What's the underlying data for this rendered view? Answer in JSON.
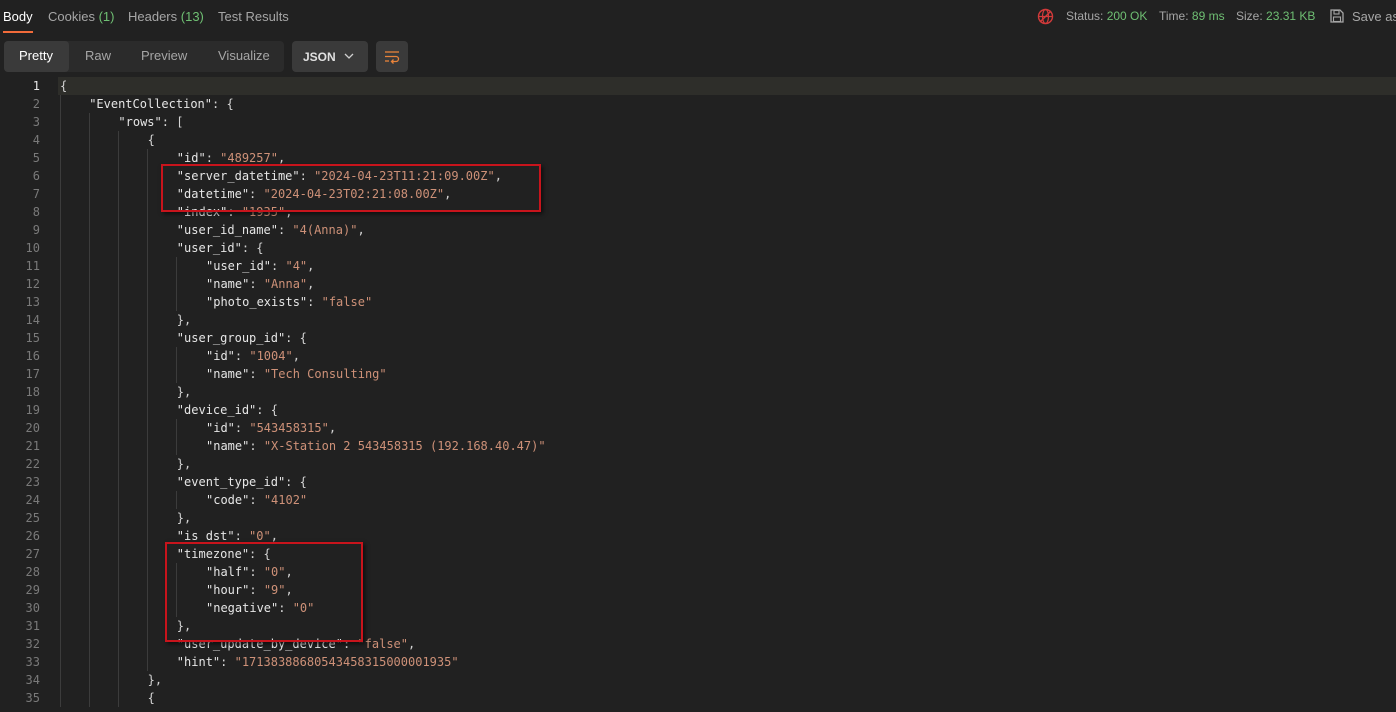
{
  "top_tabs": [
    {
      "label": "Body",
      "count": ""
    },
    {
      "label": "Cookies",
      "count": "(1)"
    },
    {
      "label": "Headers",
      "count": "(13)"
    },
    {
      "label": "Test Results",
      "count": ""
    }
  ],
  "status": {
    "status_label": "Status:",
    "status_value": "200 OK",
    "time_label": "Time:",
    "time_value": "89 ms",
    "size_label": "Size:",
    "size_value": "23.31 KB"
  },
  "save_label": "Save as",
  "view_tabs": [
    "Pretty",
    "Raw",
    "Preview",
    "Visualize"
  ],
  "format_select": "JSON",
  "code_lines": [
    {
      "n": "1",
      "indent": 0,
      "parts": [
        [
          "p",
          "{"
        ]
      ]
    },
    {
      "n": "2",
      "indent": 1,
      "parts": [
        [
          "k",
          "\"EventCollection\""
        ],
        [
          "p",
          ": {"
        ]
      ]
    },
    {
      "n": "3",
      "indent": 2,
      "parts": [
        [
          "k",
          "\"rows\""
        ],
        [
          "p",
          ": ["
        ]
      ]
    },
    {
      "n": "4",
      "indent": 3,
      "parts": [
        [
          "p",
          "{"
        ]
      ]
    },
    {
      "n": "5",
      "indent": 4,
      "parts": [
        [
          "k",
          "\"id\""
        ],
        [
          "p",
          ": "
        ],
        [
          "s",
          "\"489257\""
        ],
        [
          "p",
          ","
        ]
      ]
    },
    {
      "n": "6",
      "indent": 4,
      "parts": [
        [
          "k",
          "\"server_datetime\""
        ],
        [
          "p",
          ": "
        ],
        [
          "s",
          "\"2024-04-23T11:21:09.00Z\""
        ],
        [
          "p",
          ","
        ]
      ]
    },
    {
      "n": "7",
      "indent": 4,
      "parts": [
        [
          "k",
          "\"datetime\""
        ],
        [
          "p",
          ": "
        ],
        [
          "s",
          "\"2024-04-23T02:21:08.00Z\""
        ],
        [
          "p",
          ","
        ]
      ]
    },
    {
      "n": "8",
      "indent": 4,
      "parts": [
        [
          "k",
          "\"index\""
        ],
        [
          "p",
          ": "
        ],
        [
          "s",
          "\"1935\""
        ],
        [
          "p",
          ","
        ]
      ]
    },
    {
      "n": "9",
      "indent": 4,
      "parts": [
        [
          "k",
          "\"user_id_name\""
        ],
        [
          "p",
          ": "
        ],
        [
          "s",
          "\"4(Anna)\""
        ],
        [
          "p",
          ","
        ]
      ]
    },
    {
      "n": "10",
      "indent": 4,
      "parts": [
        [
          "k",
          "\"user_id\""
        ],
        [
          "p",
          ": {"
        ]
      ]
    },
    {
      "n": "11",
      "indent": 5,
      "parts": [
        [
          "k",
          "\"user_id\""
        ],
        [
          "p",
          ": "
        ],
        [
          "s",
          "\"4\""
        ],
        [
          "p",
          ","
        ]
      ]
    },
    {
      "n": "12",
      "indent": 5,
      "parts": [
        [
          "k",
          "\"name\""
        ],
        [
          "p",
          ": "
        ],
        [
          "s",
          "\"Anna\""
        ],
        [
          "p",
          ","
        ]
      ]
    },
    {
      "n": "13",
      "indent": 5,
      "parts": [
        [
          "k",
          "\"photo_exists\""
        ],
        [
          "p",
          ": "
        ],
        [
          "s",
          "\"false\""
        ]
      ]
    },
    {
      "n": "14",
      "indent": 4,
      "parts": [
        [
          "p",
          "},"
        ]
      ]
    },
    {
      "n": "15",
      "indent": 4,
      "parts": [
        [
          "k",
          "\"user_group_id\""
        ],
        [
          "p",
          ": {"
        ]
      ]
    },
    {
      "n": "16",
      "indent": 5,
      "parts": [
        [
          "k",
          "\"id\""
        ],
        [
          "p",
          ": "
        ],
        [
          "s",
          "\"1004\""
        ],
        [
          "p",
          ","
        ]
      ]
    },
    {
      "n": "17",
      "indent": 5,
      "parts": [
        [
          "k",
          "\"name\""
        ],
        [
          "p",
          ": "
        ],
        [
          "s",
          "\"Tech Consulting\""
        ]
      ]
    },
    {
      "n": "18",
      "indent": 4,
      "parts": [
        [
          "p",
          "},"
        ]
      ]
    },
    {
      "n": "19",
      "indent": 4,
      "parts": [
        [
          "k",
          "\"device_id\""
        ],
        [
          "p",
          ": {"
        ]
      ]
    },
    {
      "n": "20",
      "indent": 5,
      "parts": [
        [
          "k",
          "\"id\""
        ],
        [
          "p",
          ": "
        ],
        [
          "s",
          "\"543458315\""
        ],
        [
          "p",
          ","
        ]
      ]
    },
    {
      "n": "21",
      "indent": 5,
      "parts": [
        [
          "k",
          "\"name\""
        ],
        [
          "p",
          ": "
        ],
        [
          "s",
          "\"X-Station 2 543458315 (192.168.40.47)\""
        ]
      ]
    },
    {
      "n": "22",
      "indent": 4,
      "parts": [
        [
          "p",
          "},"
        ]
      ]
    },
    {
      "n": "23",
      "indent": 4,
      "parts": [
        [
          "k",
          "\"event_type_id\""
        ],
        [
          "p",
          ": {"
        ]
      ]
    },
    {
      "n": "24",
      "indent": 5,
      "parts": [
        [
          "k",
          "\"code\""
        ],
        [
          "p",
          ": "
        ],
        [
          "s",
          "\"4102\""
        ]
      ]
    },
    {
      "n": "25",
      "indent": 4,
      "parts": [
        [
          "p",
          "},"
        ]
      ]
    },
    {
      "n": "26",
      "indent": 4,
      "parts": [
        [
          "k",
          "\"is_dst\""
        ],
        [
          "p",
          ": "
        ],
        [
          "s",
          "\"0\""
        ],
        [
          "p",
          ","
        ]
      ]
    },
    {
      "n": "27",
      "indent": 4,
      "parts": [
        [
          "k",
          "\"timezone\""
        ],
        [
          "p",
          ": {"
        ]
      ]
    },
    {
      "n": "28",
      "indent": 5,
      "parts": [
        [
          "k",
          "\"half\""
        ],
        [
          "p",
          ": "
        ],
        [
          "s",
          "\"0\""
        ],
        [
          "p",
          ","
        ]
      ]
    },
    {
      "n": "29",
      "indent": 5,
      "parts": [
        [
          "k",
          "\"hour\""
        ],
        [
          "p",
          ": "
        ],
        [
          "s",
          "\"9\""
        ],
        [
          "p",
          ","
        ]
      ]
    },
    {
      "n": "30",
      "indent": 5,
      "parts": [
        [
          "k",
          "\"negative\""
        ],
        [
          "p",
          ": "
        ],
        [
          "s",
          "\"0\""
        ]
      ]
    },
    {
      "n": "31",
      "indent": 4,
      "parts": [
        [
          "p",
          "},"
        ]
      ]
    },
    {
      "n": "32",
      "indent": 4,
      "parts": [
        [
          "k",
          "\"user_update_by_device\""
        ],
        [
          "p",
          ": "
        ],
        [
          "s",
          "\"false\""
        ],
        [
          "p",
          ","
        ]
      ]
    },
    {
      "n": "33",
      "indent": 4,
      "parts": [
        [
          "k",
          "\"hint\""
        ],
        [
          "p",
          ": "
        ],
        [
          "s",
          "\"17138388680543458315000001935\""
        ]
      ]
    },
    {
      "n": "34",
      "indent": 3,
      "parts": [
        [
          "p",
          "},"
        ]
      ]
    },
    {
      "n": "35",
      "indent": 3,
      "parts": [
        [
          "p",
          "{"
        ]
      ]
    }
  ],
  "colors": {
    "accent": "#f26b3a",
    "success": "#6fbf73",
    "highlight_box": "#c8141c",
    "key": "#e6e6e6",
    "string": "#ce9178"
  }
}
